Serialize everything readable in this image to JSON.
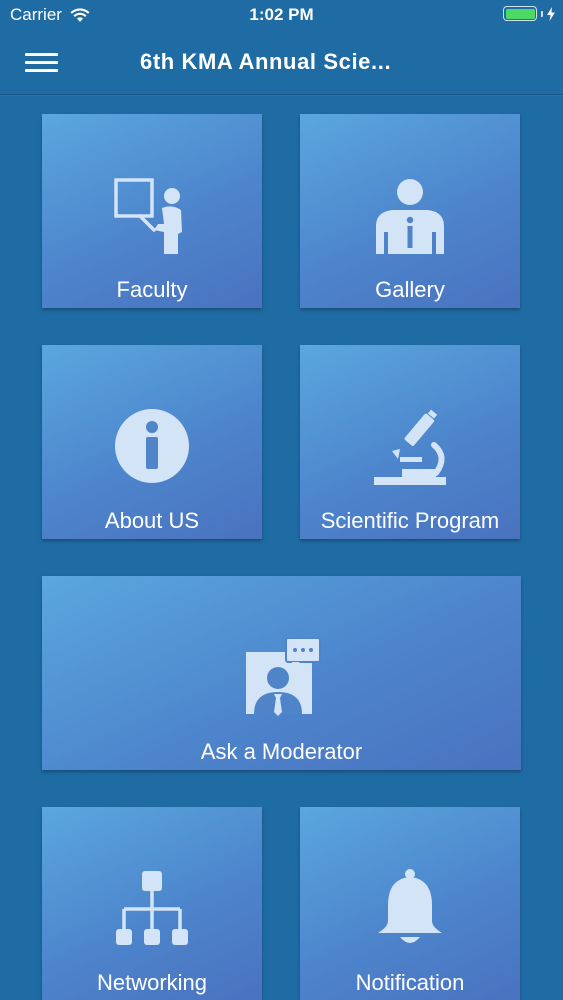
{
  "status_bar": {
    "carrier": "Carrier",
    "time": "1:02 PM",
    "battery_color": "#4cd964"
  },
  "nav": {
    "title": "6th KMA Annual Scie...",
    "menu_icon": "hamburger-menu-icon"
  },
  "tiles": [
    {
      "label": "Faculty",
      "icon": "presenter-icon"
    },
    {
      "label": "Gallery",
      "icon": "person-tie-icon"
    },
    {
      "label": "About US",
      "icon": "info-icon"
    },
    {
      "label": "Scientific Program",
      "icon": "microscope-icon"
    },
    {
      "label": "Ask a Moderator",
      "icon": "moderator-chat-icon"
    },
    {
      "label": "Networking",
      "icon": "network-tree-icon"
    },
    {
      "label": "Notification",
      "icon": "bell-icon"
    }
  ],
  "colors": {
    "background": "#1f6ba4",
    "tile_gradient_start": "#5aa7de",
    "tile_gradient_end": "#4a72bf",
    "icon_fill": "#d3e4f6"
  }
}
